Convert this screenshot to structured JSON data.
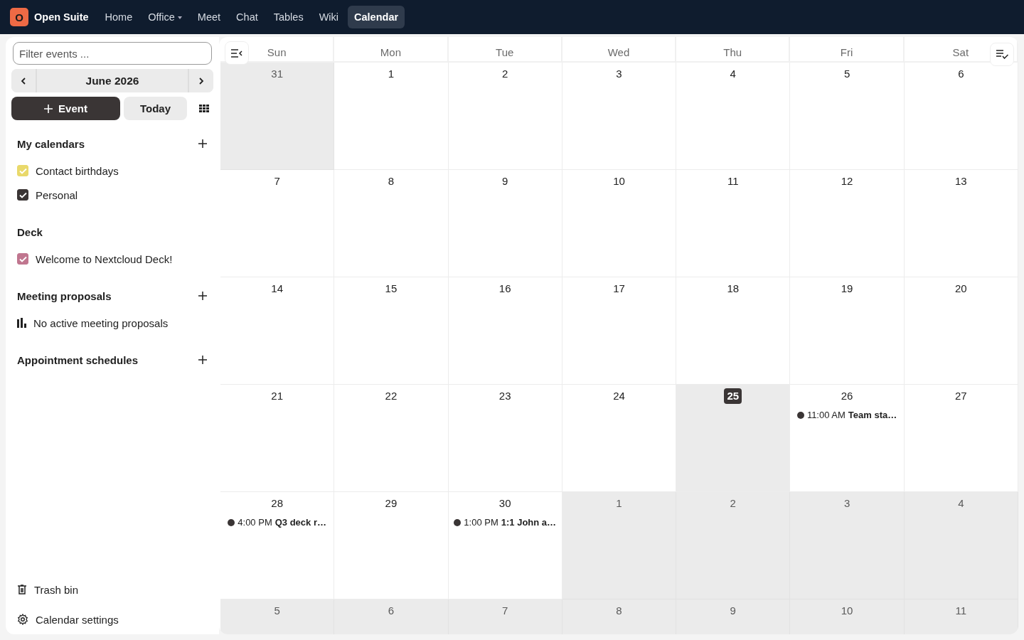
{
  "topbar": {
    "logo_letter": "O",
    "app_name": "Open Suite",
    "nav": [
      {
        "label": "Home",
        "selected": false,
        "dropdown": false
      },
      {
        "label": "Office",
        "selected": false,
        "dropdown": true
      },
      {
        "label": "Meet",
        "selected": false,
        "dropdown": false
      },
      {
        "label": "Chat",
        "selected": false,
        "dropdown": false
      },
      {
        "label": "Tables",
        "selected": false,
        "dropdown": false
      },
      {
        "label": "Wiki",
        "selected": false,
        "dropdown": false
      },
      {
        "label": "Calendar",
        "selected": true,
        "dropdown": false
      }
    ]
  },
  "sidebar": {
    "filter": {
      "placeholder": "Filter events ..."
    },
    "month_label": "June 2026",
    "new_event_button": "Event",
    "today_button": "Today",
    "sections": [
      {
        "title": "My calendars",
        "addable": true,
        "items": [
          {
            "kind": "calendar",
            "label": "Contact birthdays",
            "checked": true,
            "color": "#e9d96b"
          },
          {
            "kind": "calendar",
            "label": "Personal",
            "checked": true,
            "color": "#3a3535"
          }
        ]
      },
      {
        "title": "Deck",
        "addable": false,
        "items": [
          {
            "kind": "calendar",
            "label": "Welcome to Nextcloud Deck!",
            "checked": true,
            "color": "#c0768f"
          }
        ]
      },
      {
        "title": "Meeting proposals",
        "addable": true,
        "items": [
          {
            "kind": "info",
            "label": "No active meeting proposals"
          }
        ]
      },
      {
        "title": "Appointment schedules",
        "addable": true
      }
    ],
    "footer": [
      {
        "kind": "trash",
        "label": "Trash bin"
      },
      {
        "kind": "settings",
        "label": "Calendar settings"
      }
    ]
  },
  "calendar": {
    "weekdays": [
      "Sun",
      "Mon",
      "Tue",
      "Wed",
      "Thu",
      "Fri",
      "Sat"
    ],
    "weeks": [
      [
        {
          "day": "31",
          "outside": true,
          "today": false
        },
        {
          "day": "1",
          "outside": false,
          "today": false
        },
        {
          "day": "2",
          "outside": false,
          "today": false
        },
        {
          "day": "3",
          "outside": false,
          "today": false
        },
        {
          "day": "4",
          "outside": false,
          "today": false
        },
        {
          "day": "5",
          "outside": false,
          "today": false
        },
        {
          "day": "6",
          "outside": false,
          "today": false
        }
      ],
      [
        {
          "day": "7",
          "outside": false,
          "today": false
        },
        {
          "day": "8",
          "outside": false,
          "today": false
        },
        {
          "day": "9",
          "outside": false,
          "today": false
        },
        {
          "day": "10",
          "outside": false,
          "today": false
        },
        {
          "day": "11",
          "outside": false,
          "today": false
        },
        {
          "day": "12",
          "outside": false,
          "today": false
        },
        {
          "day": "13",
          "outside": false,
          "today": false
        }
      ],
      [
        {
          "day": "14",
          "outside": false,
          "today": false
        },
        {
          "day": "15",
          "outside": false,
          "today": false
        },
        {
          "day": "16",
          "outside": false,
          "today": false
        },
        {
          "day": "17",
          "outside": false,
          "today": false
        },
        {
          "day": "18",
          "outside": false,
          "today": false
        },
        {
          "day": "19",
          "outside": false,
          "today": false
        },
        {
          "day": "20",
          "outside": false,
          "today": false
        }
      ],
      [
        {
          "day": "21",
          "outside": false,
          "today": false
        },
        {
          "day": "22",
          "outside": false,
          "today": false
        },
        {
          "day": "23",
          "outside": false,
          "today": false
        },
        {
          "day": "24",
          "outside": false,
          "today": false
        },
        {
          "day": "25",
          "outside": false,
          "today": true
        },
        {
          "day": "26",
          "outside": false,
          "today": false,
          "events": [
            {
              "time": "11:00 AM",
              "title": "Team sta…",
              "color": "#3a3535"
            }
          ]
        },
        {
          "day": "27",
          "outside": false,
          "today": false
        }
      ],
      [
        {
          "day": "28",
          "outside": false,
          "today": false,
          "events": [
            {
              "time": "4:00 PM",
              "title": "Q3 deck r…",
              "color": "#3a3535"
            }
          ]
        },
        {
          "day": "29",
          "outside": false,
          "today": false
        },
        {
          "day": "30",
          "outside": false,
          "today": false,
          "events": [
            {
              "time": "1:00 PM",
              "title": "1:1 John a…",
              "color": "#3a3535"
            }
          ]
        },
        {
          "day": "1",
          "outside": true,
          "today": false
        },
        {
          "day": "2",
          "outside": true,
          "today": false
        },
        {
          "day": "3",
          "outside": true,
          "today": false
        },
        {
          "day": "4",
          "outside": true,
          "today": false
        }
      ],
      [
        {
          "day": "5",
          "outside": true,
          "today": false
        },
        {
          "day": "6",
          "outside": true,
          "today": false
        },
        {
          "day": "7",
          "outside": true,
          "today": false
        },
        {
          "day": "8",
          "outside": true,
          "today": false
        },
        {
          "day": "9",
          "outside": true,
          "today": false
        },
        {
          "day": "10",
          "outside": true,
          "today": false
        },
        {
          "day": "11",
          "outside": true,
          "today": false
        }
      ]
    ]
  }
}
